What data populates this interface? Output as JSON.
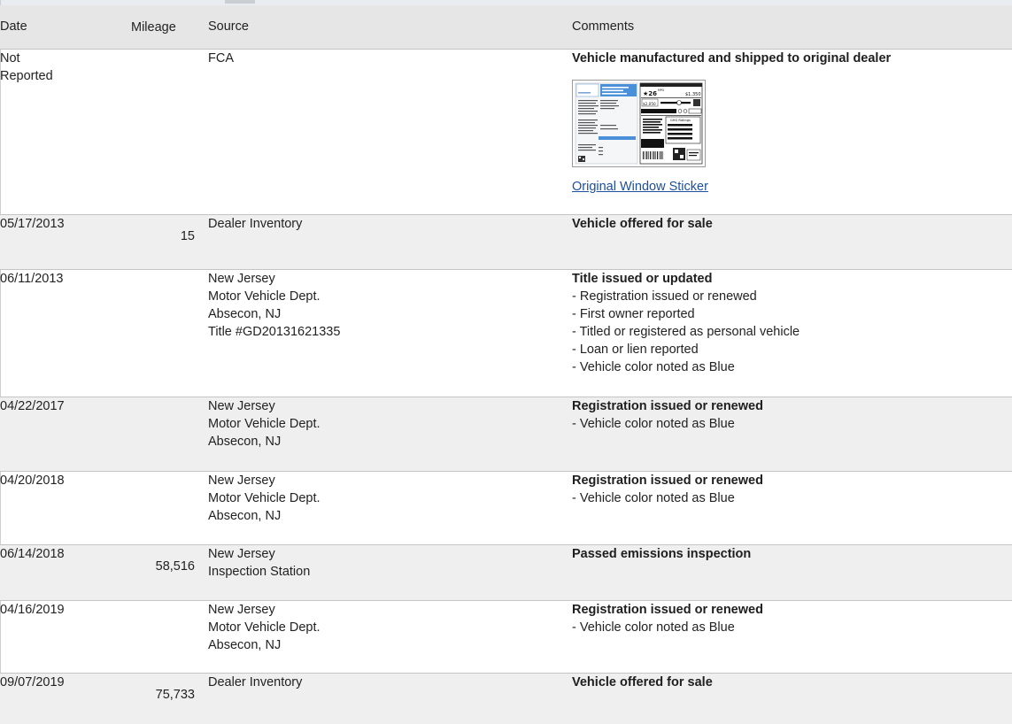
{
  "headers": {
    "date": "Date",
    "mileage": "Mileage",
    "source": "Source",
    "comments": "Comments"
  },
  "records": [
    {
      "date": "Not Reported",
      "mileage": "",
      "source": [
        "FCA"
      ],
      "comment_title": "Vehicle manufactured and shipped to original dealer",
      "comment_items": [],
      "sticker": {
        "link_text": "Original Window Sticker",
        "mpg": "26",
        "mpg_unit": "MPG",
        "price": "$1,350",
        "fuel_cost": "$2,050",
        "ratings_label": "GHG Ratings"
      }
    },
    {
      "date": "05/17/2013",
      "mileage": "15",
      "source": [
        "Dealer Inventory"
      ],
      "comment_title": "Vehicle offered for sale",
      "comment_items": []
    },
    {
      "date": "06/11/2013",
      "mileage": "",
      "source": [
        "New Jersey",
        "Motor Vehicle Dept.",
        "Absecon, NJ",
        "Title #GD20131621335"
      ],
      "comment_title": "Title issued or updated",
      "comment_items": [
        "- Registration issued or renewed",
        "- First owner reported",
        "- Titled or registered as personal vehicle",
        "- Loan or lien reported",
        "- Vehicle color noted as Blue"
      ]
    },
    {
      "date": "04/22/2017",
      "mileage": "",
      "source": [
        "New Jersey",
        "Motor Vehicle Dept.",
        "Absecon, NJ"
      ],
      "comment_title": "Registration issued or renewed",
      "comment_items": [
        "- Vehicle color noted as Blue"
      ]
    },
    {
      "date": "04/20/2018",
      "mileage": "",
      "source": [
        "New Jersey",
        "Motor Vehicle Dept.",
        "Absecon, NJ"
      ],
      "comment_title": "Registration issued or renewed",
      "comment_items": [
        "- Vehicle color noted as Blue"
      ]
    },
    {
      "date": "06/14/2018",
      "mileage": "58,516",
      "source": [
        "New Jersey",
        "Inspection Station"
      ],
      "comment_title": "Passed emissions inspection",
      "comment_items": []
    },
    {
      "date": "04/16/2019",
      "mileage": "",
      "source": [
        "New Jersey",
        "Motor Vehicle Dept.",
        "Absecon, NJ"
      ],
      "comment_title": "Registration issued or renewed",
      "comment_items": [
        "- Vehicle color noted as Blue"
      ]
    },
    {
      "date": "09/07/2019",
      "mileage": "75,733",
      "source": [
        "Dealer Inventory"
      ],
      "comment_title": "Vehicle offered for sale",
      "comment_items": []
    }
  ],
  "colors": {
    "header_bg": "#e6e6e6",
    "row_alt_bg": "#efefef",
    "row_divider": "#c4c4c4",
    "link": "#1c4f9e",
    "sticker_accent": "#4a90d9"
  }
}
